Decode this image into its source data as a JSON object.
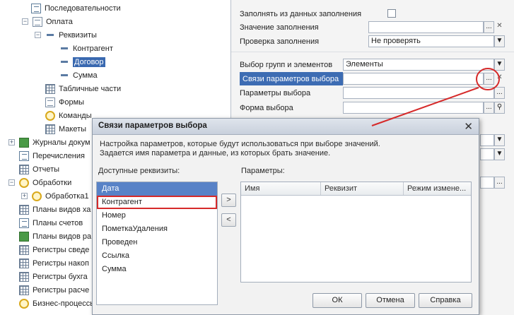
{
  "tree": {
    "items": [
      {
        "label": "Последовательности"
      },
      {
        "label": "Оплата"
      },
      {
        "label": "Реквизиты"
      },
      {
        "label": "Контрагент"
      },
      {
        "label": "Договор"
      },
      {
        "label": "Сумма"
      },
      {
        "label": "Табличные части"
      },
      {
        "label": "Формы"
      },
      {
        "label": "Команды"
      },
      {
        "label": "Макеты"
      },
      {
        "label": "Журналы докум"
      },
      {
        "label": "Перечисления"
      },
      {
        "label": "Отчеты"
      },
      {
        "label": "Обработки"
      },
      {
        "label": "Обработка1"
      },
      {
        "label": "Планы видов ха"
      },
      {
        "label": "Планы счетов"
      },
      {
        "label": "Планы видов ра"
      },
      {
        "label": "Регистры сведе"
      },
      {
        "label": "Регистры накоп"
      },
      {
        "label": "Регистры бухга"
      },
      {
        "label": "Регистры расче"
      },
      {
        "label": "Бизнес-процессы"
      }
    ]
  },
  "props": {
    "fill_from_data_label": "Заполнять из данных заполнения",
    "fill_value_label": "Значение заполнения",
    "fill_check_label": "Проверка заполнения",
    "fill_check_value": "Не проверять",
    "select_groups_label": "Выбор групп и элементов",
    "select_groups_value": "Элементы",
    "links_label": "Связи параметров выбора",
    "choice_params_label": "Параметры выбора",
    "choice_form_label": "Форма выбора",
    "ellipsis": "...",
    "clear": "✕",
    "dropdown": "▼",
    "search": "⚲"
  },
  "dialog": {
    "title": "Связи параметров выбора",
    "close": "✕",
    "desc_line1": "Настройка параметров, которые будут использоваться при выборе значений.",
    "desc_line2": "Задается имя параметра и данные, из которых брать значение.",
    "available_label": "Доступные реквизиты:",
    "params_label": "Параметры:",
    "available": [
      {
        "label": "Дата"
      },
      {
        "label": "Контрагент"
      },
      {
        "label": "Номер"
      },
      {
        "label": "ПометкаУдаления"
      },
      {
        "label": "Проведен"
      },
      {
        "label": "Ссылка"
      },
      {
        "label": "Сумма"
      }
    ],
    "add_btn": ">",
    "remove_btn": "<",
    "columns": [
      "Имя",
      "Реквизит",
      "Режим измене..."
    ],
    "ok": "ОК",
    "cancel": "Отмена",
    "help": "Справка"
  },
  "colors": {
    "selection": "#3d6cb3",
    "annotation": "#d62a2a"
  }
}
